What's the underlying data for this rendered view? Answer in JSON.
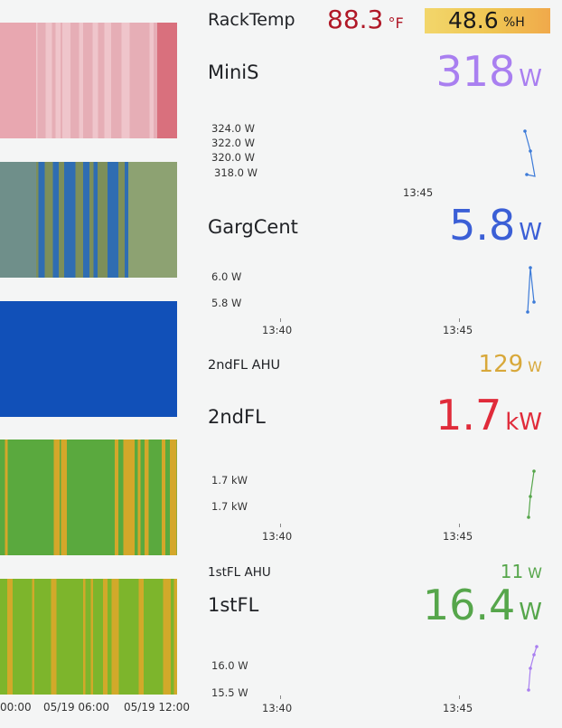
{
  "rack": {
    "name": "RackTemp",
    "temp_value": "88.3",
    "temp_unit": "°F",
    "hum_value": "48.6",
    "hum_unit": "%H"
  },
  "minis": {
    "title": "MiniS",
    "value": "318",
    "unit": "W",
    "yticks": [
      "324.0 W",
      "322.0 W",
      "320.0 W",
      "318.0 W"
    ],
    "xticks": [
      "13:45"
    ],
    "color": "#a97ff0"
  },
  "gargcent": {
    "title": "GargCent",
    "value": "5.8",
    "unit": "W",
    "yticks": [
      "6.0 W",
      "5.8 W"
    ],
    "xticks": [
      "13:40",
      "13:45"
    ],
    "color": "#3b5fd6"
  },
  "ahu2": {
    "title": "2ndFL AHU",
    "value": "129",
    "unit": "W",
    "color": "#d8a83a"
  },
  "fl2": {
    "title": "2ndFL",
    "value": "1.7",
    "unit": "kW",
    "yticks": [
      "1.7 kW",
      "1.7 kW"
    ],
    "xticks": [
      "13:40",
      "13:45"
    ],
    "color": "#e02b3a"
  },
  "ahu1": {
    "title": "1stFL AHU",
    "value": "11",
    "unit": "W",
    "color": "#56a64b"
  },
  "fl1": {
    "title": "1stFL",
    "value": "16.4",
    "unit": "W",
    "yticks": [
      "16.0 W",
      "15.5 W"
    ],
    "xticks": [
      "13:40",
      "13:45"
    ],
    "color": "#56a64b"
  },
  "timeline": {
    "xticks": [
      "00:00",
      "05/19 06:00",
      "05/19 12:00"
    ]
  }
}
